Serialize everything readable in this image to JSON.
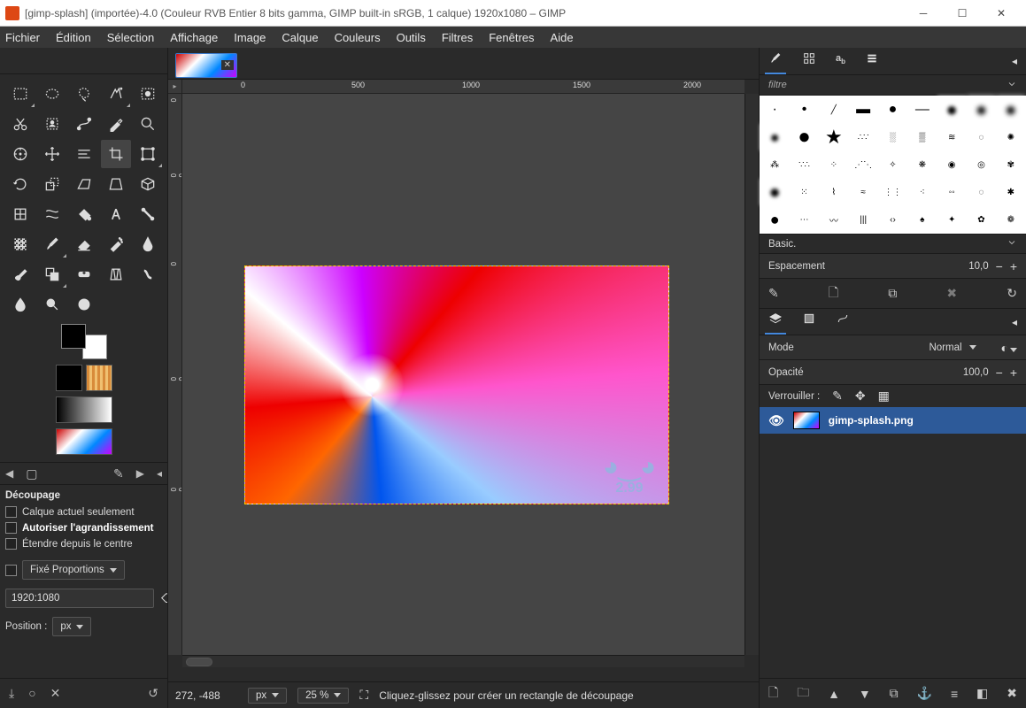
{
  "title": "[gimp-splash] (importée)-4.0 (Couleur RVB Entier 8 bits gamma, GIMP built-in sRGB, 1 calque) 1920x1080 – GIMP",
  "menus": [
    "Fichier",
    "Édition",
    "Sélection",
    "Affichage",
    "Image",
    "Calque",
    "Couleurs",
    "Outils",
    "Filtres",
    "Fenêtres",
    "Aide"
  ],
  "ruler_top": [
    "0",
    "500",
    "1000",
    "1500",
    "2000"
  ],
  "ruler_left": [
    "0",
    "500",
    "1000",
    "0"
  ],
  "status": {
    "coords": "272, -488",
    "unit": "px",
    "zoom": "25 %",
    "hint": "Cliquez-glissez pour créer un rectangle de découpage"
  },
  "tool_options": {
    "title": "Découpage",
    "chk1": "Calque actuel seulement",
    "chk2": "Autoriser l'agrandissement",
    "chk3": "Étendre depuis le centre",
    "fixed": "Fixé Proportions",
    "ratio": "1920:1080",
    "position_label": "Position :",
    "unit": "px"
  },
  "brushes": {
    "filter_placeholder": "filtre",
    "selected_name": "Basic.",
    "spacing_label": "Espacement",
    "spacing_value": "10,0"
  },
  "layers": {
    "tabs_mode_label": "Mode",
    "mode_value": "Normal",
    "opacity_label": "Opacité",
    "opacity_value": "100,0",
    "lock_label": "Verrouiller :",
    "layer_name": "gimp-splash.png"
  },
  "wilber_version": "2.99"
}
